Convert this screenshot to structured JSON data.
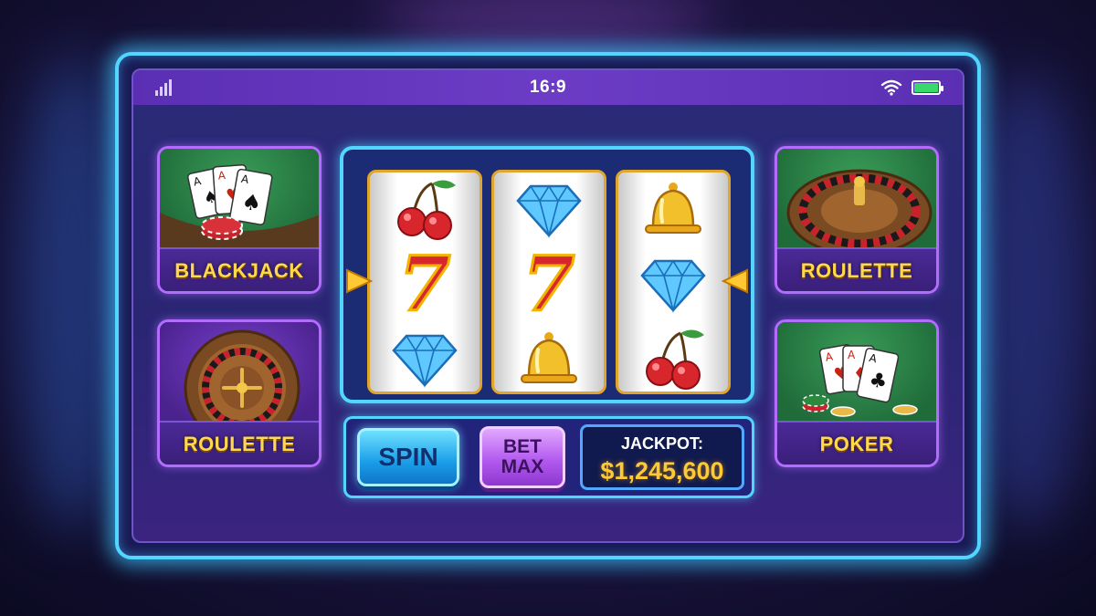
{
  "status_bar": {
    "title": "16:9",
    "signal_icon": "signal-bars-icon",
    "wifi_icon": "wifi-icon",
    "battery_icon": "battery-icon",
    "battery_color": "#38d86a"
  },
  "games_left": [
    {
      "label": "BLACKJACK",
      "icon": "playing-cards-chips-icon"
    },
    {
      "label": "ROULETTE",
      "icon": "roulette-wheel-icon"
    }
  ],
  "games_right": [
    {
      "label": "ROULETTE",
      "icon": "roulette-wheel-icon"
    },
    {
      "label": "POKER",
      "icon": "playing-cards-chips-icon"
    }
  ],
  "slot_machine": {
    "reels": [
      [
        "cherry",
        "seven",
        "diamond"
      ],
      [
        "diamond",
        "seven",
        "bell"
      ],
      [
        "bell",
        "diamond",
        "cherry"
      ]
    ],
    "seven_glyph": "7",
    "payline_indicator_color": "#ffc933"
  },
  "controls": {
    "spin_label": "SPIN",
    "bet_line1": "BET",
    "bet_line2": "MAX",
    "jackpot_label": "JACKPOT:",
    "jackpot_value": "$1,245,600"
  },
  "colors": {
    "accent": "#52d6ff",
    "tile_border": "#b46cff",
    "label_gold": "#ffd84d",
    "status_bar": "#6c3cc6"
  }
}
